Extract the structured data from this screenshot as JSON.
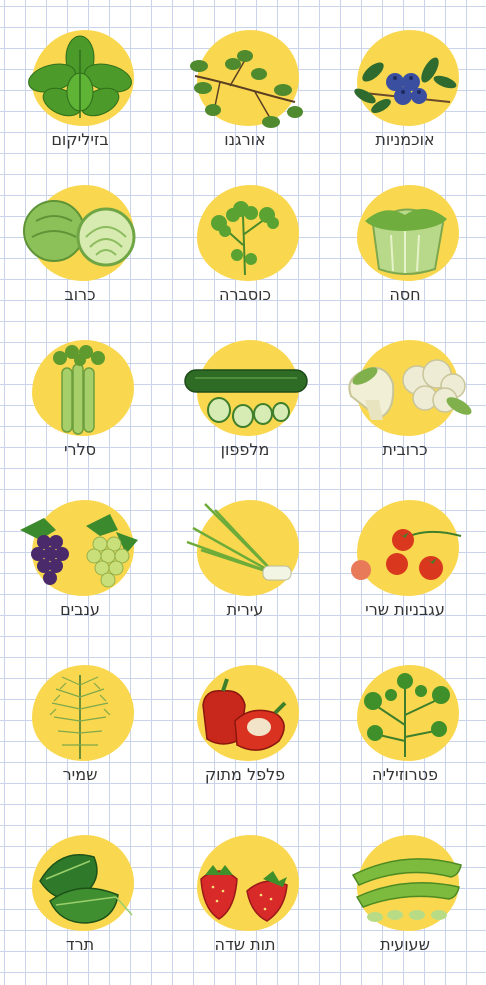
{
  "items": [
    {
      "label": "אוכמניות",
      "icon": "blueberries-icon"
    },
    {
      "label": "אורגנו",
      "icon": "oregano-icon"
    },
    {
      "label": "בזיליקום",
      "icon": "basil-icon"
    },
    {
      "label": "חסה",
      "icon": "lettuce-icon"
    },
    {
      "label": "כוסברה",
      "icon": "coriander-icon"
    },
    {
      "label": "כרוב",
      "icon": "cabbage-icon"
    },
    {
      "label": "כרובית",
      "icon": "cauliflower-icon"
    },
    {
      "label": "מלפפון",
      "icon": "cucumber-icon"
    },
    {
      "label": "סלרי",
      "icon": "celery-icon"
    },
    {
      "label": "עגבניות שרי",
      "icon": "cherry-tomatoes-icon"
    },
    {
      "label": "עירית",
      "icon": "chives-icon"
    },
    {
      "label": "ענבים",
      "icon": "grapes-icon"
    },
    {
      "label": "פטרוזיליה",
      "icon": "parsley-icon"
    },
    {
      "label": "פלפל מתוק",
      "icon": "sweet-pepper-icon"
    },
    {
      "label": "שמיר",
      "icon": "dill-icon"
    },
    {
      "label": "שעועית",
      "icon": "green-beans-icon"
    },
    {
      "label": "תות שדה",
      "icon": "strawberries-icon"
    },
    {
      "label": "תרד",
      "icon": "spinach-icon"
    }
  ]
}
